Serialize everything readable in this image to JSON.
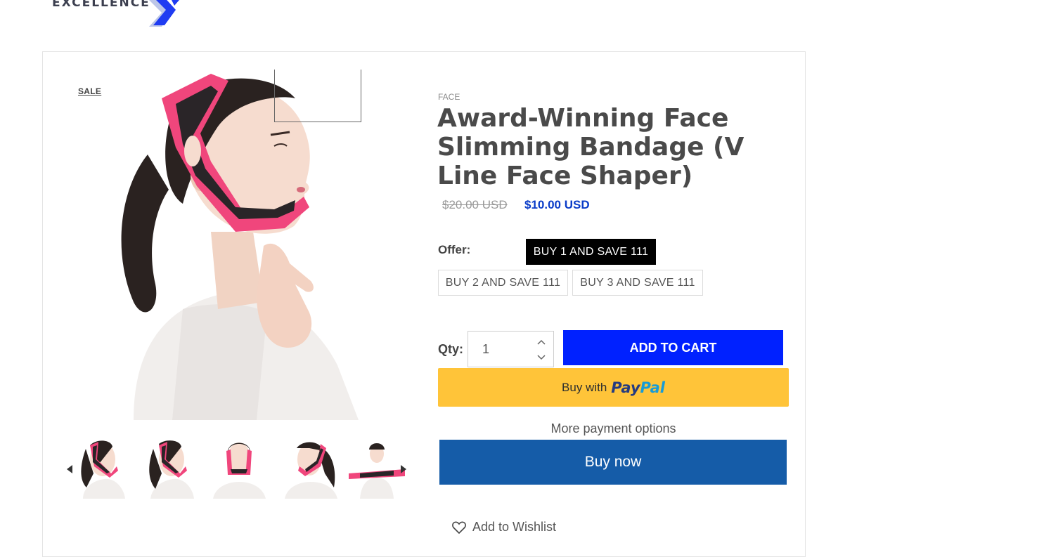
{
  "brand": {
    "logo_text": "EXCELLENCE",
    "accent": "#1f3cf2"
  },
  "product": {
    "sale_badge": "SALE",
    "collection": "FACE",
    "title": "Award-Winning Face Slimming Bandage (V Line Face Shaper)",
    "price_compare": "$20.00 USD",
    "price": "$10.00 USD"
  },
  "offer": {
    "label": "Offer:",
    "options": [
      {
        "label": "BUY 1 AND SAVE 111",
        "selected": true
      },
      {
        "label": "BUY 2 AND SAVE 111",
        "selected": false
      },
      {
        "label": "BUY 3 AND SAVE 111",
        "selected": false
      }
    ]
  },
  "quantity": {
    "label": "Qty:",
    "value": "1"
  },
  "buttons": {
    "add_to_cart": "ADD TO CART",
    "paypal_prefix": "Buy with",
    "paypal_pay": "Pay",
    "paypal_pal": "Pal",
    "more_payment_options": "More payment options",
    "buy_now": "Buy now",
    "wishlist": "Add to Wishlist"
  },
  "gallery": {
    "thumbnails": [
      "thumb-side-left",
      "thumb-side-left-2",
      "thumb-front",
      "thumb-side-right",
      "thumb-holding-band"
    ]
  },
  "colors": {
    "add_to_cart": "#0021ff",
    "paypal": "#ffc439",
    "buy_now": "#155ca8",
    "price": "#0a3cc8",
    "band_pink": "#f0467c",
    "band_black": "#2a2528"
  }
}
